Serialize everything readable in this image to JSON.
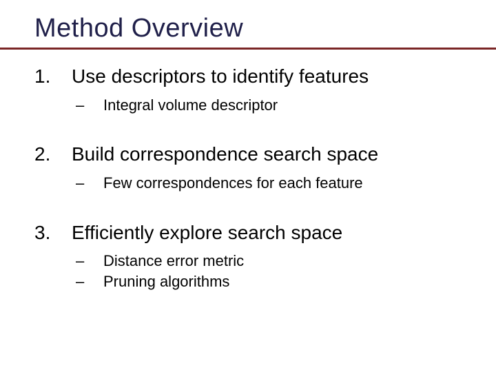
{
  "title": "Method Overview",
  "items": [
    {
      "num": "1.",
      "text": "Use descriptors to identify features",
      "sub": [
        {
          "dash": "–",
          "text": "Integral volume descriptor"
        }
      ]
    },
    {
      "num": "2.",
      "text": "Build correspondence search space",
      "sub": [
        {
          "dash": "–",
          "text": "Few correspondences for each feature"
        }
      ]
    },
    {
      "num": "3.",
      "text": "Efficiently explore search space",
      "sub": [
        {
          "dash": "–",
          "text": "Distance error metric"
        },
        {
          "dash": "–",
          "text": "Pruning algorithms"
        }
      ]
    }
  ]
}
